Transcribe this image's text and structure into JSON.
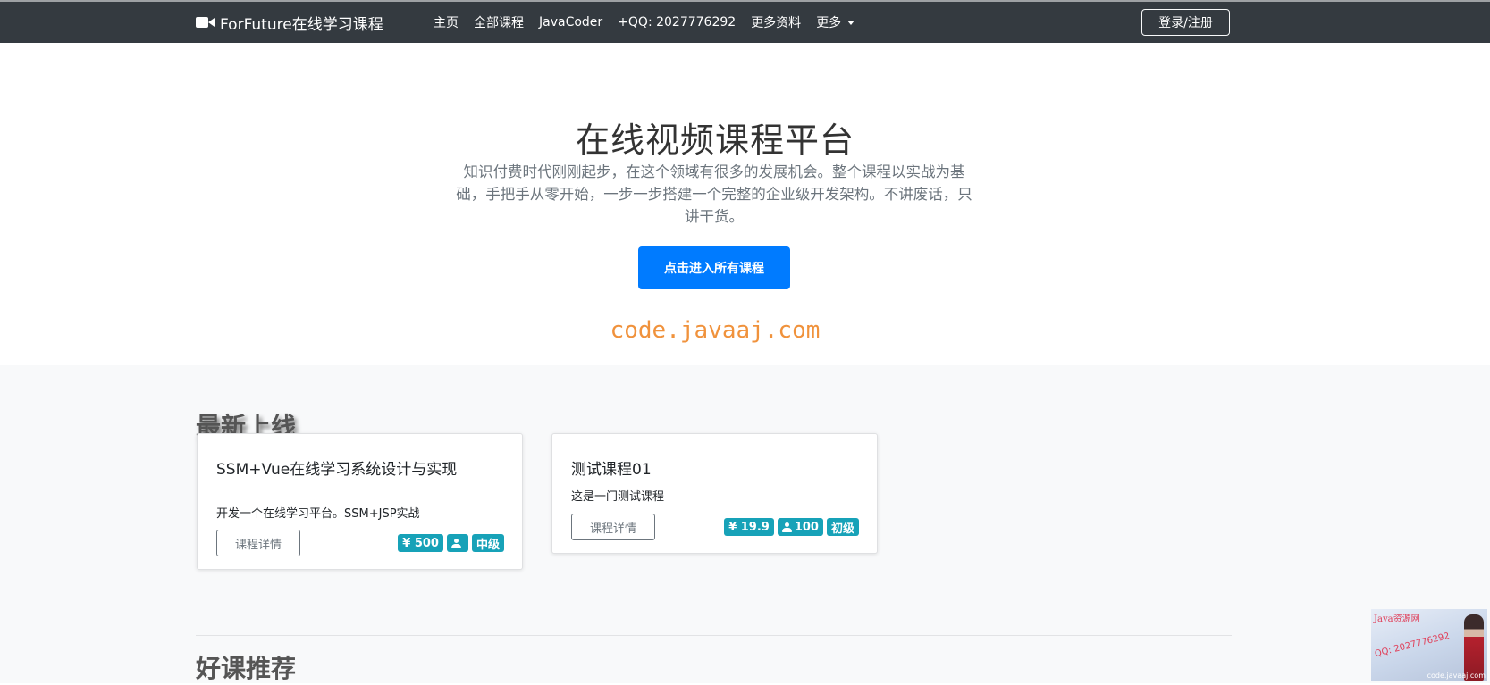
{
  "navbar": {
    "brand": "ForFuture在线学习课程",
    "links": [
      "主页",
      "全部课程",
      "JavaCoder",
      "+QQ: 2027776292",
      "更多资料"
    ],
    "more": "更多",
    "login": "登录/注册"
  },
  "hero": {
    "title": "在线视频课程平台",
    "description": "知识付费时代刚刚起步，在这个领域有很多的发展机会。整个课程以实战为基础，手把手从零开始，一步一步搭建一个完整的企业级开发架构。不讲废话，只讲干货。",
    "button": "点击进入所有课程",
    "watermark": "code.javaaj.com"
  },
  "latest": {
    "title": "最新上线",
    "courses": [
      {
        "title": "SSM+Vue在线学习系统设计与实现",
        "summary": "开发一个在线学习平台。SSM+JSP实战",
        "detail_button": "课程详情",
        "price": "¥ 500",
        "enrolled": "",
        "level": "中级"
      },
      {
        "title": "测试课程01",
        "summary": "这是一门测试课程",
        "detail_button": "课程详情",
        "price": "¥ 19.9",
        "enrolled": "100",
        "level": "初级"
      }
    ]
  },
  "recommended": {
    "title": "好课推荐"
  },
  "ad": {
    "title": "Java资源网",
    "qq": "QQ: 2027776292",
    "site": "code.javaaj.com"
  },
  "colors": {
    "navbar": "#343a40",
    "primary": "#007bff",
    "badge": "#17a2b8",
    "watermark": "#f0923c",
    "section_bg": "#f8f9fa"
  },
  "icons": [
    "video-camera-icon",
    "caret-down-icon",
    "user-icon"
  ]
}
